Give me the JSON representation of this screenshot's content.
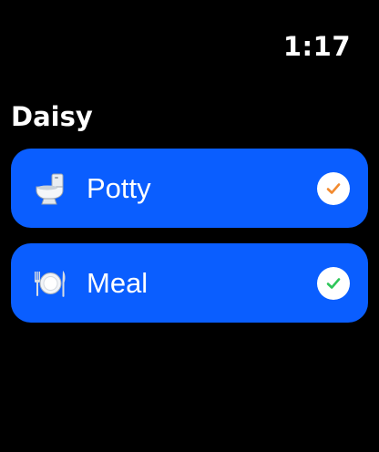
{
  "status_bar": {
    "time": "1:17"
  },
  "screen": {
    "title": "Daisy"
  },
  "rows": [
    {
      "label": "Potty",
      "icon": "toilet-icon",
      "checked": true,
      "check_color": "#f28a2e"
    },
    {
      "label": "Meal",
      "icon": "plate-icon",
      "checked": true,
      "check_color": "#2fc65a"
    }
  ],
  "colors": {
    "background": "#000000",
    "row_background": "#0a5eff",
    "text": "#ffffff"
  }
}
